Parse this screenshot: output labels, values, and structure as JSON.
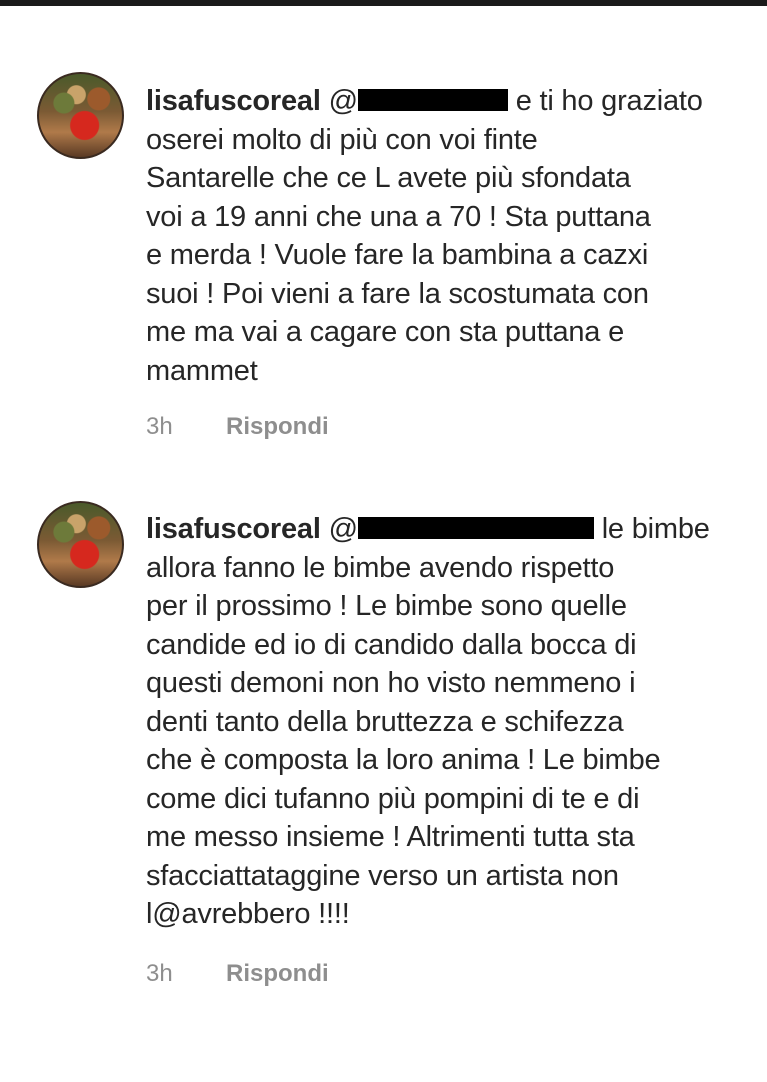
{
  "comments": [
    {
      "username": "lisafuscoreal",
      "mention_prefix": "@",
      "text_after_mention": "e ti ho graziato",
      "text": "oserei molto di più con voi finte\nSantarelle che ce L avete più sfondata\nvoi a 19 anni che una a 70 ! Sta puttana\ne merda ! Vuole fare la bambina a cazxi\nsuoi ! Poi vieni a fare la scostumata con\nme ma vai a cagare con sta puttana e\nmammet",
      "time": "3h",
      "reply_label": "Rispondi"
    },
    {
      "username": "lisafuscoreal",
      "mention_prefix": "@",
      "text_after_mention": "le bimbe",
      "text": "allora fanno le bimbe avendo rispetto\nper il prossimo ! Le bimbe sono quelle\ncandide ed io di candido dalla bocca di\nquesti demoni non ho visto nemmeno i\ndenti tanto della bruttezza e schifezza\nche è composta la loro anima ! Le bimbe\ncome dici tufanno più pompini di te e di\nme messo insieme ! Altrimenti tutta sta\nsfacciattataggine verso un artista non\nl@avrebbero !!!!",
      "time": "3h",
      "reply_label": "Rispondi"
    }
  ]
}
